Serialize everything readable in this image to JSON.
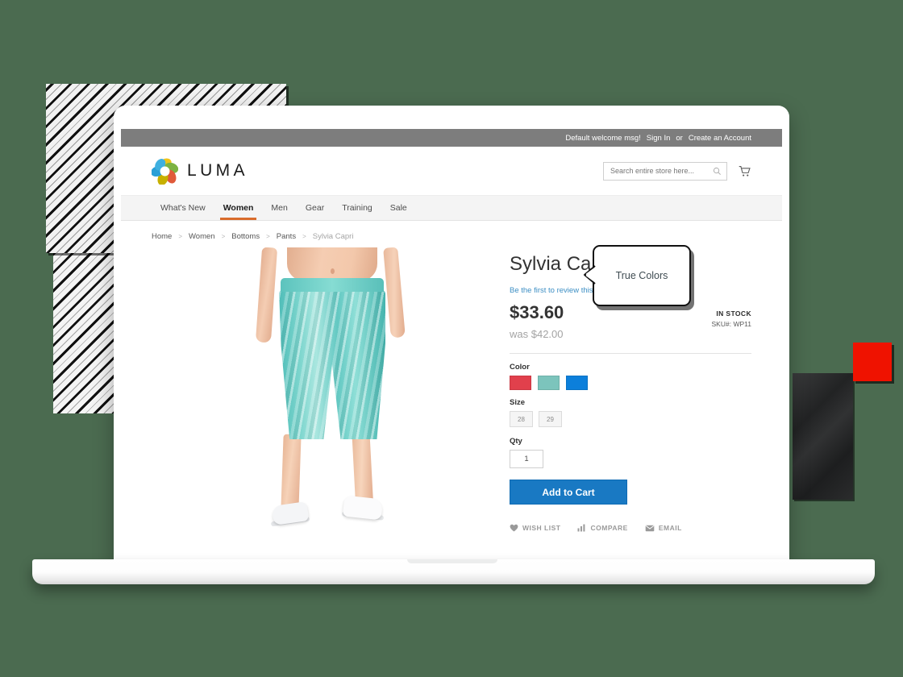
{
  "topbar": {
    "welcome": "Default welcome msg!",
    "sign_in": "Sign In",
    "or": "or",
    "create_account": "Create an Account"
  },
  "header": {
    "brand": "LUMA",
    "logo_icon": "luma-flower-logo",
    "search": {
      "placeholder": "Search entire store here...",
      "value": "",
      "icon": "search-icon"
    },
    "cart_icon": "shopping-cart-icon"
  },
  "nav": {
    "items": [
      {
        "label": "What's New",
        "active": false
      },
      {
        "label": "Women",
        "active": true
      },
      {
        "label": "Men",
        "active": false
      },
      {
        "label": "Gear",
        "active": false
      },
      {
        "label": "Training",
        "active": false
      },
      {
        "label": "Sale",
        "active": false
      }
    ],
    "active_accent": "#d96c2c"
  },
  "breadcrumb": {
    "items": [
      "Home",
      "Women",
      "Bottoms",
      "Pants",
      "Sylvia Capri"
    ],
    "separator": ">"
  },
  "product": {
    "title": "Sylvia Capri",
    "review_link": "Be the first to review this product",
    "price": "$33.60",
    "old_price": "was $42.00",
    "stock_status": "IN STOCK",
    "sku_label": "SKU#:",
    "sku_value": "WP11",
    "image_alt": "model wearing teal striped capri leggings and white sneakers",
    "options": {
      "color_label": "Color",
      "colors": [
        {
          "name": "red",
          "hex": "#e1404c"
        },
        {
          "name": "teal",
          "hex": "#7cc4bc"
        },
        {
          "name": "blue",
          "hex": "#0c7fdb"
        }
      ],
      "size_label": "Size",
      "sizes": [
        "28",
        "29"
      ]
    },
    "qty_label": "Qty",
    "qty_value": "1",
    "add_to_cart": "Add to Cart",
    "add_to_cart_color": "#1979c3",
    "actions": [
      {
        "label": "WISH LIST",
        "icon": "heart-icon"
      },
      {
        "label": "COMPARE",
        "icon": "compare-bars-icon"
      },
      {
        "label": "EMAIL",
        "icon": "envelope-icon"
      }
    ]
  },
  "callout": {
    "text": "True Colors"
  },
  "decor": {
    "background_color": "#4b6b50",
    "red_square_color": "#ef1200",
    "hatch_pattern": "diagonal-stripes"
  }
}
